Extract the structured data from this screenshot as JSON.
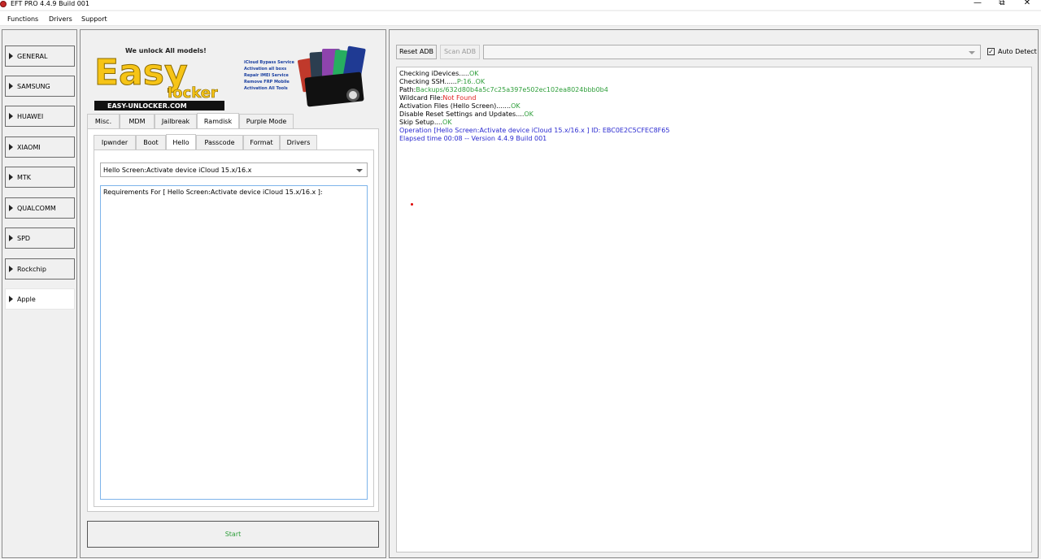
{
  "window": {
    "title": "EFT PRO 4.4.9 Build 001",
    "controls": {
      "minimize": "—",
      "maximize": "⧉",
      "close": "✕"
    }
  },
  "menu": [
    "Functions",
    "Drivers",
    "Support"
  ],
  "categories": [
    "GENERAL",
    "SAMSUNG",
    "HUAWEI",
    "XIAOMI",
    "MTK",
    "QUALCOMM",
    "SPD",
    "Rockchip",
    "Apple"
  ],
  "selected_category": "Apple",
  "logo": {
    "tagline": "We unlock All models!",
    "brand_top": "Easy",
    "brand_bottom": "locker",
    "site": "EASY-UNLOCKER.COM",
    "features": [
      "iCloud Bypass Service",
      "Activation all boxs",
      "Repair IMEI Service",
      "Remove FRP Mobile",
      "Activation All Tools"
    ]
  },
  "tabs_main": [
    "Misc.",
    "MDM",
    "Jailbreak",
    "Ramdisk",
    "Purple Mode"
  ],
  "tabs_main_active": "Ramdisk",
  "tabs_sub": [
    "Ipwnder",
    "Boot",
    "Hello",
    "Passcode",
    "Format",
    "Drivers"
  ],
  "tabs_sub_active": "Hello",
  "operation_select": "Hello Screen:Activate device iCloud 15.x/16.x",
  "requirements_text": "Requirements For [ Hello Screen:Activate device iCloud 15.x/16.x ]:",
  "start_label": "Start",
  "right": {
    "reset_adb": "Reset ADB",
    "scan_adb": "Scan ADB",
    "port_value": "",
    "auto_detect": "Auto Detect",
    "auto_detect_checked": true,
    "check_mark": "✓"
  },
  "log": [
    {
      "label": "Checking iDevices.....",
      "value": "OK",
      "color": "green"
    },
    {
      "label": "Checking SSH......",
      "value": "P:16..OK",
      "color": "green"
    },
    {
      "label": "Path:",
      "value": "Backups/632d80b4a5c7c25a397e502ec102ea8024bbb0b4",
      "color": "green"
    },
    {
      "label": "Wildcard File:",
      "value": "Not Found",
      "color": "red"
    },
    {
      "label": "Activation Files (Hello Screen).......",
      "value": "OK",
      "color": "green"
    },
    {
      "label": "Disable Reset Settings and Updates....",
      "value": "OK",
      "color": "green"
    },
    {
      "label": "Skip Setup....",
      "value": "OK",
      "color": "green"
    },
    {
      "label": "",
      "value": "Operation [Hello Screen:Activate device iCloud 15.x/16.x ] ID: EBC0E2C5CFEC8F65",
      "color": "blue"
    },
    {
      "label": "",
      "value": "Elapsed time 00:08 -- Version 4.4.9 Build 001",
      "color": "blue"
    }
  ],
  "colors": {
    "ok": "#2e9e3a",
    "error": "#e02020",
    "info": "#2a2ad0",
    "logo_yellow": "#f6c417"
  }
}
